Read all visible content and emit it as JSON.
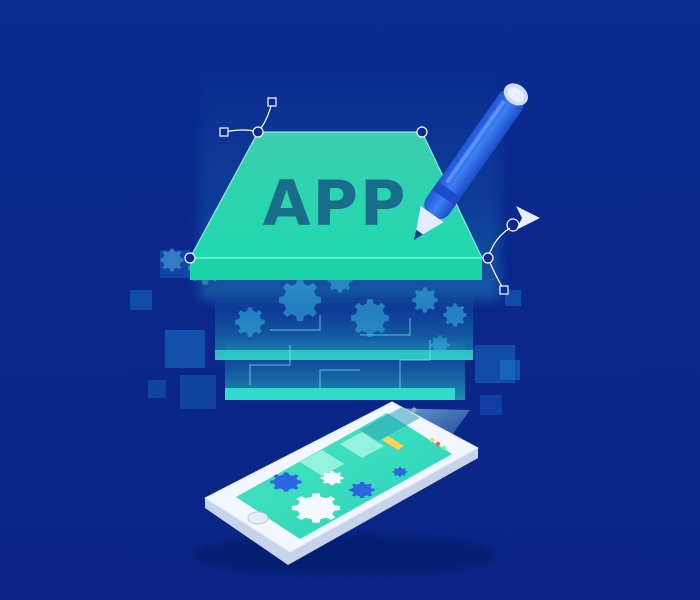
{
  "illustration": {
    "headline": "APP",
    "colors": {
      "background": "#0a2a8f",
      "accent_teal": "#2ee8b8",
      "accent_cyan": "#39d6f0",
      "pen_blue": "#2a6ff0",
      "gear_blue": "#2a67e0",
      "gear_white": "#f4f8ff"
    },
    "icons": [
      "pen-icon",
      "gear-icon",
      "cursor-arrow-icon",
      "bezier-handle-icon",
      "smartphone-icon"
    ]
  }
}
